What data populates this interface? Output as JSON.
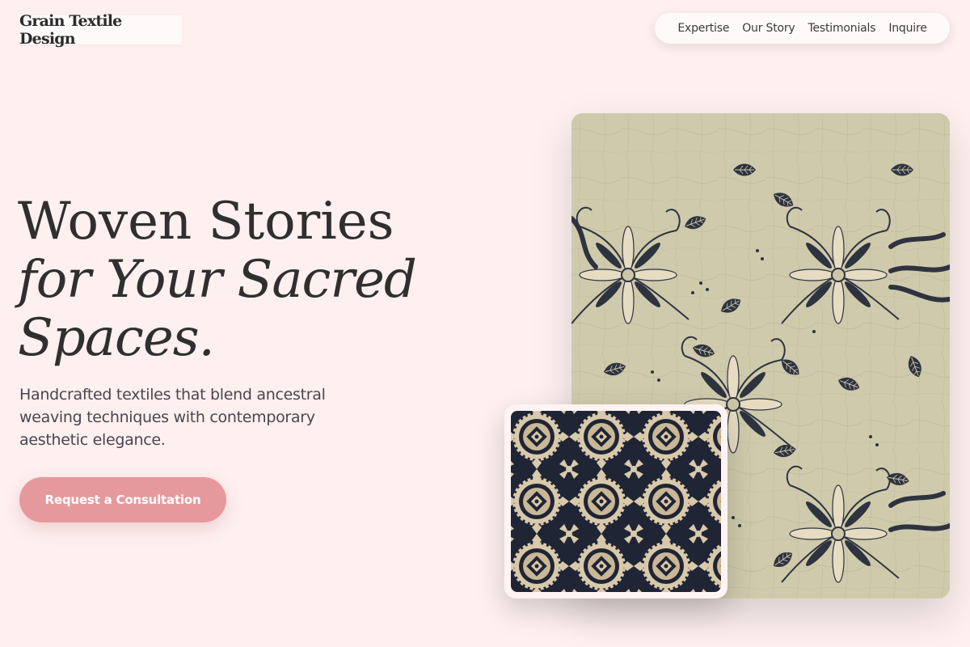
{
  "brand": {
    "name": "Grain Textile Design"
  },
  "nav": {
    "items": [
      {
        "label": "Expertise"
      },
      {
        "label": "Our Story"
      },
      {
        "label": "Testimonials"
      },
      {
        "label": "Inquire"
      }
    ]
  },
  "hero": {
    "headline_line1": "Woven Stories",
    "headline_line2": "for Your Sacred",
    "headline_line3": "Spaces.",
    "subtitle": "Handcrafted textiles that blend ancestral weaving techniques with contemporary aesthetic elegance.",
    "cta_label": "Request a Consultation"
  },
  "images": {
    "main": {
      "icon": "batik-floral-textile-image"
    },
    "secondary": {
      "icon": "batik-geometric-textile-image"
    }
  },
  "colors": {
    "background": "#fdf0ef",
    "accent": "#e6999c",
    "text": "#2f2f2f",
    "fabric_cream": "#c9c4a6",
    "fabric_navy": "#2a3040"
  }
}
